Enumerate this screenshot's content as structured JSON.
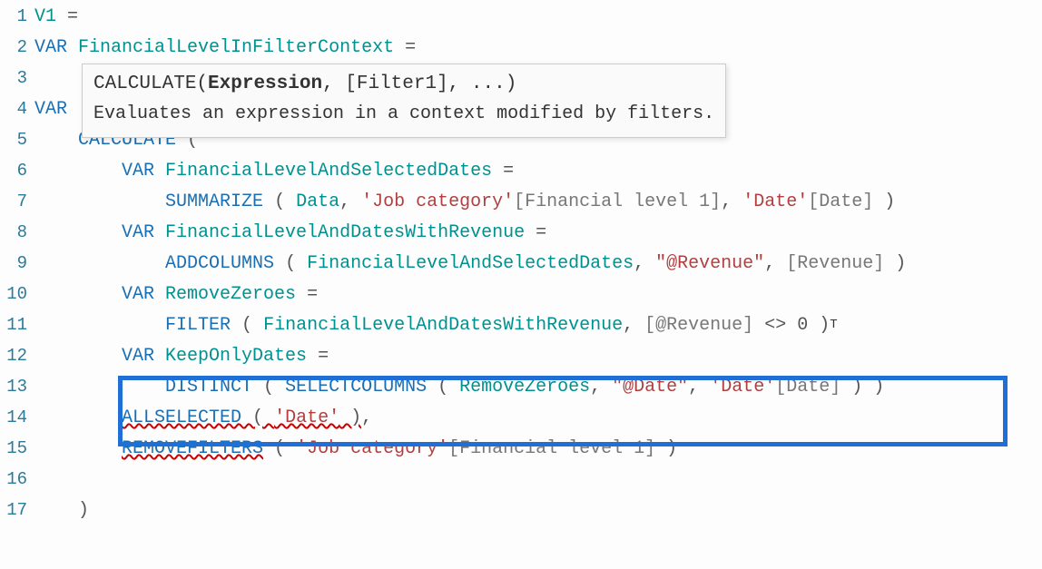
{
  "tooltip": {
    "fn": "CALCULATE",
    "arg_bold": "Expression",
    "rest": ", [Filter1], ...)",
    "desc": "Evaluates an expression in a context modified by filters."
  },
  "lines": {
    "l1_num": "1",
    "l1_ident": "V1",
    "l1_eq": " =",
    "l2_num": "2",
    "l2_var": "VAR",
    "l2_ident": " FinancialLevelInFilterContext",
    "l2_eq": " =",
    "l3_num": "3",
    "l4_num": "4",
    "l4_var": "VAR",
    "l5_num": "5",
    "l5_func": "CALCULATE",
    "l5_paren": " (",
    "l6_num": "6",
    "l6_var": "VAR",
    "l6_ident": " FinancialLevelAndSelectedDates",
    "l6_eq": " =",
    "l7_num": "7",
    "l7_func": "SUMMARIZE",
    "l7_open": " ( ",
    "l7_data": "Data",
    "l7_c1": ", ",
    "l7_str1": "'Job category'",
    "l7_col1": "[Financial level 1]",
    "l7_c2": ", ",
    "l7_str2": "'Date'",
    "l7_col2": "[Date]",
    "l7_close": " )",
    "l8_num": "8",
    "l8_var": "VAR",
    "l8_ident": " FinancialLevelAndDatesWithRevenue",
    "l8_eq": " =",
    "l9_num": "9",
    "l9_func": "ADDCOLUMNS",
    "l9_open": " ( ",
    "l9_arg1": "FinancialLevelAndSelectedDates",
    "l9_c1": ", ",
    "l9_str": "\"@Revenue\"",
    "l9_c2": ", ",
    "l9_col": "[Revenue]",
    "l9_close": " )",
    "l10_num": "10",
    "l10_var": "VAR",
    "l10_ident": " RemoveZeroes",
    "l10_eq": " =",
    "l11_num": "11",
    "l11_func": "FILTER",
    "l11_open": " ( ",
    "l11_arg1": "FinancialLevelAndDatesWithRevenue",
    "l11_c1": ", ",
    "l11_col": "[@Revenue]",
    "l11_op": " <> ",
    "l11_zero": "0",
    "l11_close": " )",
    "l11_caret": "T",
    "l12_num": "12",
    "l12_var": "VAR",
    "l12_ident": " KeepOnlyDates",
    "l12_eq": " =",
    "l13_num": "13",
    "l13_func1": "DISTINCT",
    "l13_open1": " ( ",
    "l13_func2": "SELECTCOLUMNS",
    "l13_open2": " ( ",
    "l13_arg1": "RemoveZeroes",
    "l13_c1": ", ",
    "l13_str": "\"@Date\"",
    "l13_c2": ", ",
    "l13_tbl": "'Date'",
    "l13_col": "[Date]",
    "l13_close": " ) )",
    "l14_num": "14",
    "l14_func": "ALLSELECTED",
    "l14_open": " ( ",
    "l14_str": "'Date'",
    "l14_close": " )",
    "l14_comma": ",",
    "l15_num": "15",
    "l15_func": "REMOVEFILTERS",
    "l15_open": " ( ",
    "l15_str": "'Job category'",
    "l15_col": "[Financial level 1]",
    "l15_close": " )",
    "l16_num": "16",
    "l17_num": "17",
    "l17_paren": ")"
  }
}
